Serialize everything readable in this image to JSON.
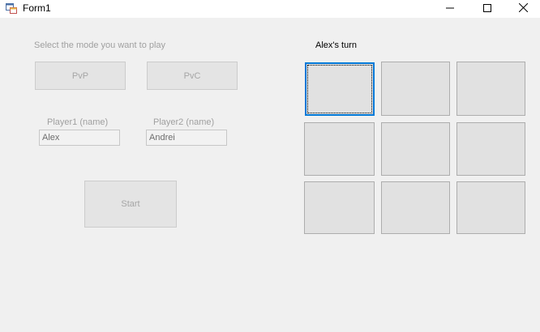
{
  "window": {
    "title": "Form1"
  },
  "icons": {
    "app": "form-app-icon",
    "minimize": "minimize-icon",
    "maximize": "maximize-icon",
    "close": "close-icon"
  },
  "mode": {
    "prompt": "Select the mode you want to play",
    "pvp_label": "PvP",
    "pvc_label": "PvC"
  },
  "players": {
    "player1_label": "Player1 (name)",
    "player1_value": "Alex",
    "player2_label": "Player2 (name)",
    "player2_value": "Andrei"
  },
  "start_label": "Start",
  "game": {
    "turn_text": "Alex's turn",
    "board": [
      [
        "",
        "",
        ""
      ],
      [
        "",
        "",
        ""
      ],
      [
        "",
        "",
        ""
      ]
    ]
  },
  "colors": {
    "focus_border": "#0078d7",
    "cell_bg": "#e1e1e1",
    "disabled_text": "#a0a0a0"
  }
}
